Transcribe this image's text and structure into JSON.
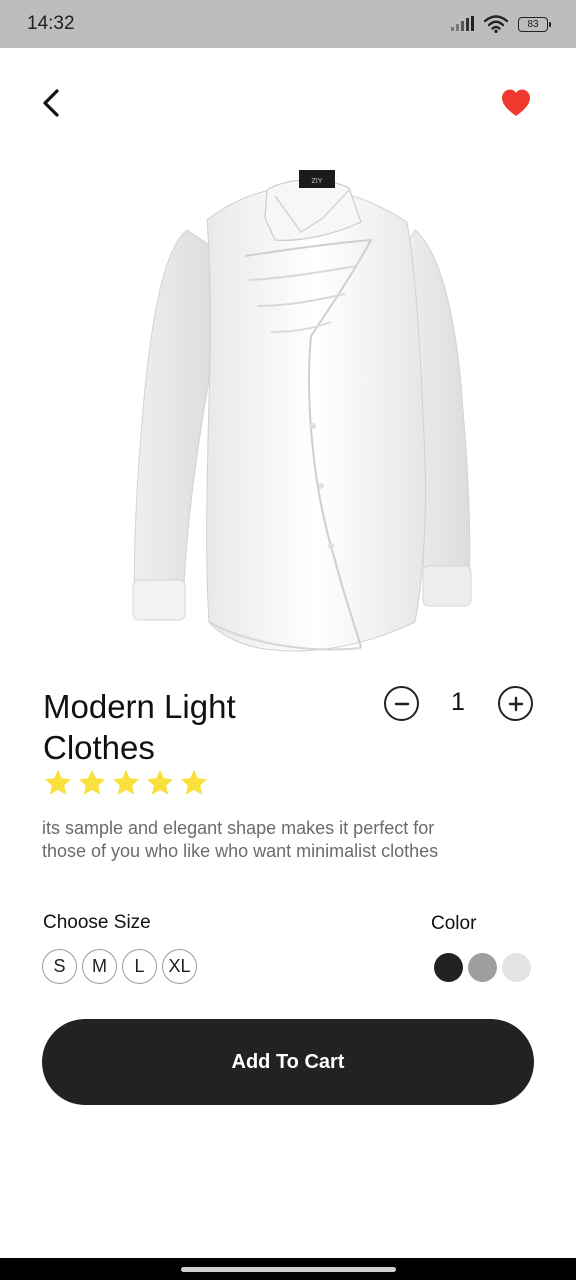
{
  "status_bar": {
    "time": "14:32",
    "battery": "83"
  },
  "product": {
    "title": "Modern Light Clothes",
    "rating": 5,
    "description": "its sample and elegant shape makes it perfect for those of you who like who want minimalist clothes",
    "brand_tag": "ZIY",
    "quantity": "1"
  },
  "size": {
    "label": "Choose Size",
    "options": [
      "S",
      "M",
      "L",
      "XL"
    ]
  },
  "color": {
    "label": "Color",
    "options": [
      "#222222",
      "#9e9e9e",
      "#e3e3e3"
    ]
  },
  "cta": {
    "add_to_cart_label": "Add To Cart"
  },
  "icons": {
    "back": "chevron-left-icon",
    "favorite": "heart-icon",
    "minus": "minus-icon",
    "plus": "plus-icon",
    "star": "star-icon"
  },
  "accent_colors": {
    "heart": "#f0392e",
    "star": "#f9e03c",
    "button": "#222222"
  }
}
